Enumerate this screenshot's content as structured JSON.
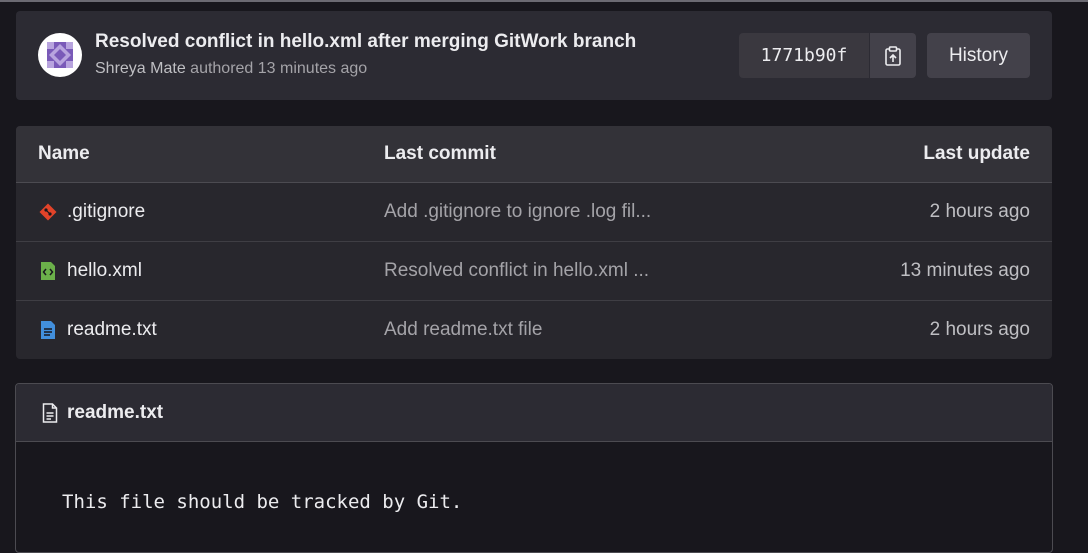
{
  "commit": {
    "title": "Resolved conflict in hello.xml after merging GitWork branch",
    "author": "Shreya Mate",
    "authored_text": " authored 13 minutes ago",
    "sha": "1771b90f",
    "history_label": "History",
    "avatar_icon": "identicon-avatar",
    "copy_icon": "clipboard-copy-icon"
  },
  "table": {
    "headers": {
      "name": "Name",
      "last_commit": "Last commit",
      "last_update": "Last update"
    },
    "rows": [
      {
        "name": ".gitignore",
        "icon": "git-file-icon",
        "last_commit": "Add .gitignore to ignore .log fil...",
        "last_update": "2 hours ago"
      },
      {
        "name": "hello.xml",
        "icon": "code-file-icon",
        "last_commit": "Resolved conflict in hello.xml ...",
        "last_update": "13 minutes ago"
      },
      {
        "name": "readme.txt",
        "icon": "text-file-icon",
        "last_commit": "Add readme.txt file",
        "last_update": "2 hours ago"
      }
    ]
  },
  "readme": {
    "filename": "readme.txt",
    "icon": "document-icon",
    "content": "This file should be tracked by Git."
  },
  "colors": {
    "page_bg": "#18171d",
    "card_bg": "#2c2b33",
    "avatar_purple": "#7a5ab8",
    "git_icon_orange": "#e24329",
    "xml_icon_green": "#6bb04a",
    "txt_icon_blue": "#428fdc"
  }
}
